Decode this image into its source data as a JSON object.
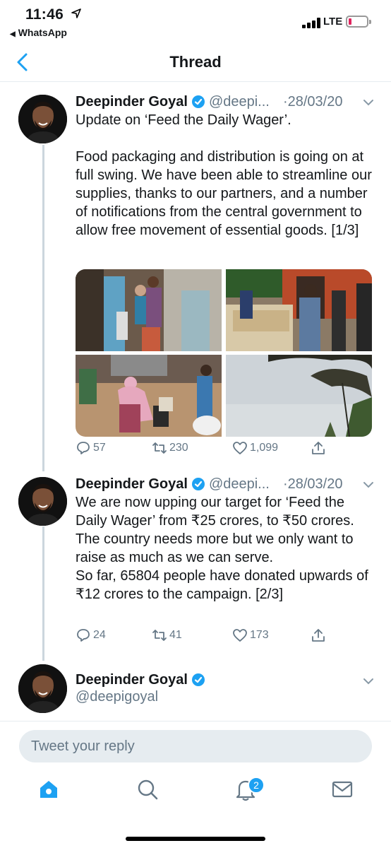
{
  "status_bar": {
    "time": "11:46",
    "back_app": "WhatsApp",
    "network": "LTE",
    "battery_color": "#e0245e"
  },
  "header": {
    "title": "Thread"
  },
  "tweets": [
    {
      "name": "Deepinder Goyal",
      "handle": "@deepi...",
      "date": "·28/03/20",
      "text": "Update on ‘Feed the Daily Wager’.\n\nFood packaging and distribution is going on at full swing. We have been able to streamline our supplies, thanks to our partners, and a number of notifications from the central government to allow free movement of essential goods. [1/3]",
      "replies": "57",
      "retweets": "230",
      "likes": "1,099"
    },
    {
      "name": "Deepinder Goyal",
      "handle": "@deepi...",
      "date": "·28/03/20",
      "text": "We are now upping our target for ‘Feed the Daily Wager’ from ₹25 crores, to ₹50 crores. The country needs more but we only want to raise as much as we can serve.\nSo far, 65804 people have donated upwards of ₹12 crores to the campaign. [2/3]",
      "replies": "24",
      "retweets": "41",
      "likes": "173"
    },
    {
      "name": "Deepinder Goyal",
      "handle": "@deepigoyal"
    }
  ],
  "reply": {
    "placeholder": "Tweet your reply"
  },
  "tabbar": {
    "notifications_badge": "2",
    "accent": "#1da1f2"
  }
}
